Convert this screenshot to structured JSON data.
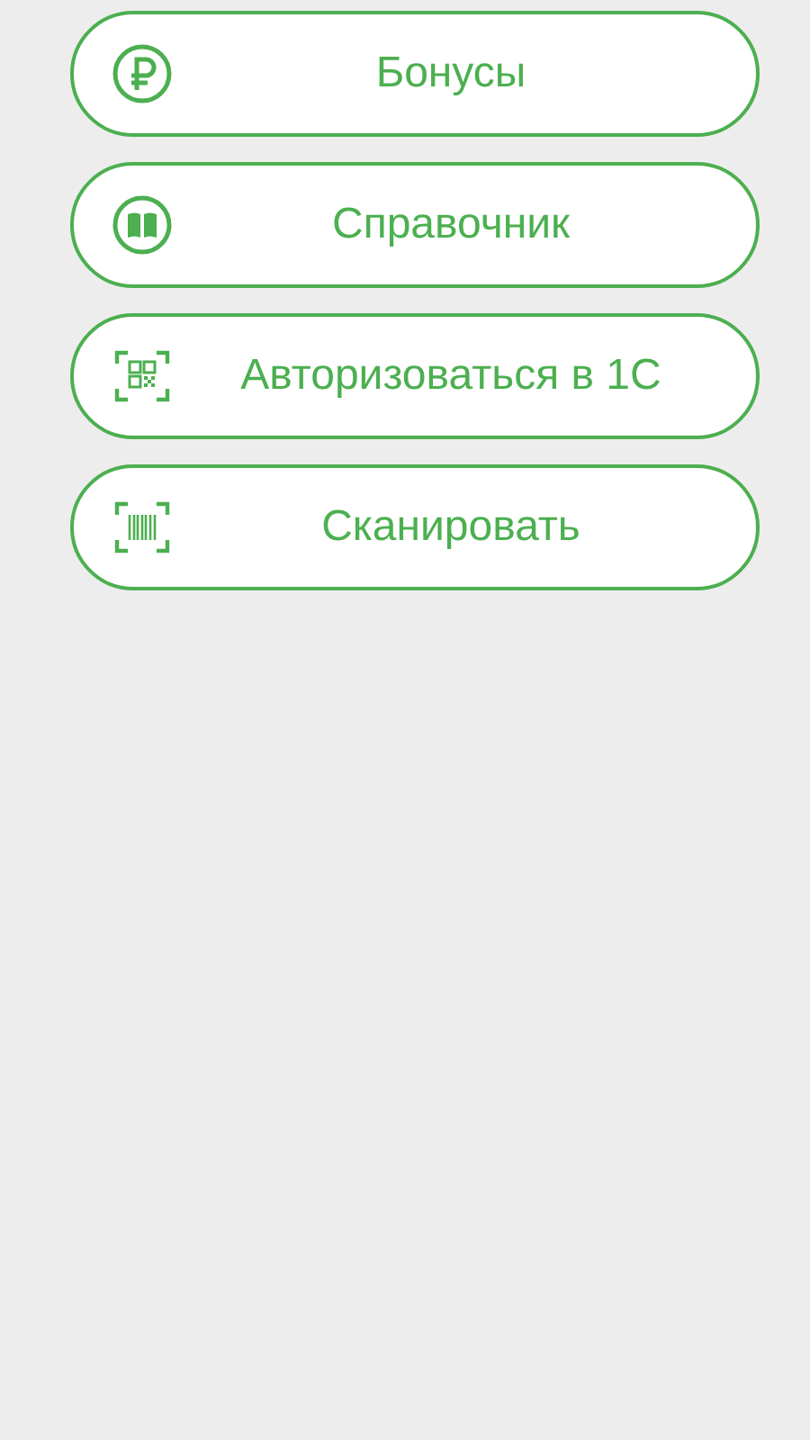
{
  "menu": [
    {
      "kind": "ruble",
      "label": "Бонусы"
    },
    {
      "kind": "book",
      "label": "Справочник"
    },
    {
      "kind": "qr",
      "label": "Авторизоваться в 1С"
    },
    {
      "kind": "barcode",
      "label": "Сканировать"
    }
  ]
}
